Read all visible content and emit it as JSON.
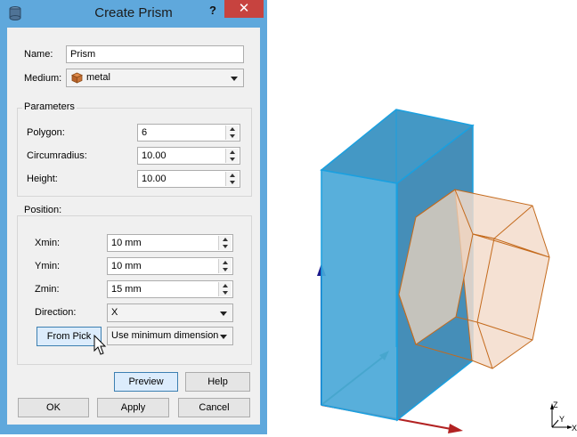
{
  "dialog": {
    "title": "Create Prism",
    "help_symbol": "?",
    "close_symbol": "✕",
    "name_label": "Name:",
    "name_value": "Prism",
    "medium_label": "Medium:",
    "medium_value": "metal",
    "parameters": {
      "title": "Parameters",
      "polygon_label": "Polygon:",
      "polygon_value": "6",
      "circumradius_label": "Circumradius:",
      "circumradius_value": "10.00",
      "height_label": "Height:",
      "height_value": "10.00"
    },
    "position": {
      "title": "Position:",
      "xmin_label": "Xmin:",
      "xmin_value": "10 mm",
      "ymin_label": "Ymin:",
      "ymin_value": "10 mm",
      "zmin_label": "Zmin:",
      "zmin_value": "15 mm",
      "direction_label": "Direction:",
      "direction_value": "X",
      "from_pick_label": "From Pick",
      "dimension_value": "Use minimum dimension"
    },
    "buttons": {
      "preview": "Preview",
      "help": "Help",
      "ok": "OK",
      "apply": "Apply",
      "cancel": "Cancel"
    }
  },
  "viewport": {
    "axis_labels": {
      "z": "Z",
      "y": "Y",
      "x": "X"
    },
    "colors": {
      "box_fill": "#4aa8d8",
      "box_edge": "#1aa0e0",
      "prism_fill": "#f3dccb",
      "prism_edge": "#c46a1c",
      "axis_z": "#1a1a8c",
      "axis_x": "#b22222",
      "axis_y": "#2e8b57"
    }
  }
}
